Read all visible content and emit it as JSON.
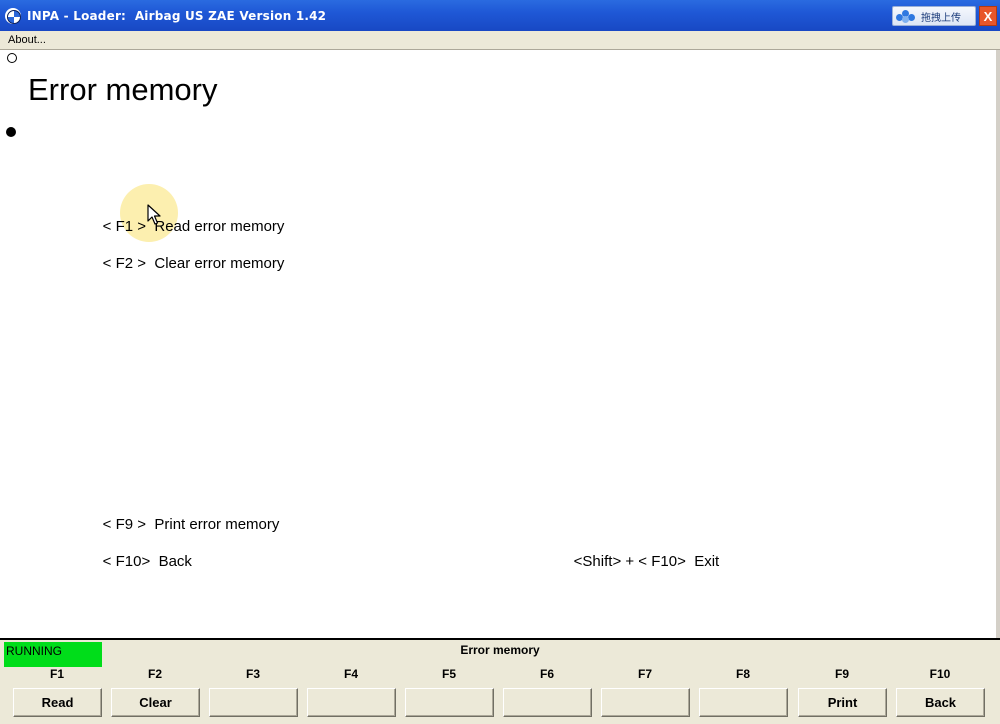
{
  "window": {
    "title": "INPA - Loader:  Airbag US ZAE Version 1.42",
    "upload_widget_label": "拖拽上传",
    "close_label": "X"
  },
  "menubar": {
    "items": [
      {
        "label": "About..."
      }
    ]
  },
  "content": {
    "heading": "Error memory",
    "options": [
      {
        "key": "< F1 >",
        "label": "Read error memory"
      },
      {
        "key": "< F2 >",
        "label": "Clear error memory"
      },
      {
        "key": "< F9 >",
        "label": "Print error memory"
      },
      {
        "key": "< F10>",
        "label": "Back"
      }
    ],
    "exit_hint": {
      "key": "<Shift> + < F10>",
      "label": "Exit"
    }
  },
  "status": {
    "state": "RUNNING",
    "state_color": "#00dd1a",
    "screen_title": "Error memory"
  },
  "function_keys": [
    {
      "key": "F1",
      "label": "Read"
    },
    {
      "key": "F2",
      "label": "Clear"
    },
    {
      "key": "F3",
      "label": ""
    },
    {
      "key": "F4",
      "label": ""
    },
    {
      "key": "F5",
      "label": ""
    },
    {
      "key": "F6",
      "label": ""
    },
    {
      "key": "F7",
      "label": ""
    },
    {
      "key": "F8",
      "label": ""
    },
    {
      "key": "F9",
      "label": "Print"
    },
    {
      "key": "F10",
      "label": "Back"
    }
  ],
  "colors": {
    "titlebar": "#1f58d6",
    "chrome": "#ece9d8",
    "cursor_highlight": "#fae16e"
  }
}
